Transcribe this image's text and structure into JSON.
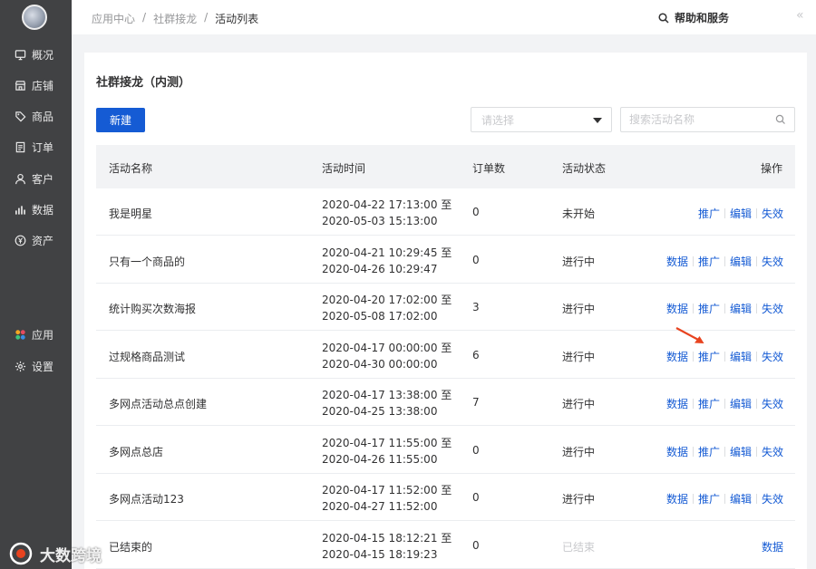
{
  "sidebar": {
    "items": [
      {
        "label": "概况",
        "icon": "monitor-icon"
      },
      {
        "label": "店铺",
        "icon": "shop-icon"
      },
      {
        "label": "商品",
        "icon": "tag-icon"
      },
      {
        "label": "订单",
        "icon": "order-icon"
      },
      {
        "label": "客户",
        "icon": "user-icon"
      },
      {
        "label": "数据",
        "icon": "bar-chart-icon"
      },
      {
        "label": "资产",
        "icon": "yen-icon"
      },
      {
        "label": "应用",
        "icon": "apps-icon"
      },
      {
        "label": "设置",
        "icon": "gear-icon"
      }
    ]
  },
  "breadcrumb": [
    "应用中心",
    "社群接龙",
    "活动列表"
  ],
  "breadcrumb_sep": "/",
  "header": {
    "help_label": "帮助和服务",
    "collapse_label": "«"
  },
  "page": {
    "title": "社群接龙（内测）",
    "new_button": "新建",
    "select_placeholder": "请选择",
    "search_placeholder": "搜索活动名称"
  },
  "table": {
    "columns": [
      "活动名称",
      "活动时间",
      "订单数",
      "活动状态",
      "操作"
    ],
    "rows": [
      {
        "name": "我是明星",
        "start": "2020-04-22 17:13:00 至",
        "end": "2020-05-03 15:13:00",
        "orders": "0",
        "status": "未开始",
        "actions": [
          "推广",
          "编辑",
          "失效"
        ]
      },
      {
        "name": "只有一个商品的",
        "start": "2020-04-21 10:29:45 至",
        "end": "2020-04-26 10:29:47",
        "orders": "0",
        "status": "进行中",
        "actions": [
          "数据",
          "推广",
          "编辑",
          "失效"
        ]
      },
      {
        "name": "统计购买次数海报",
        "start": "2020-04-20 17:02:00 至",
        "end": "2020-05-08 17:02:00",
        "orders": "3",
        "status": "进行中",
        "actions": [
          "数据",
          "推广",
          "编辑",
          "失效"
        ]
      },
      {
        "name": "过规格商品测试",
        "start": "2020-04-17 00:00:00 至",
        "end": "2020-04-30 00:00:00",
        "orders": "6",
        "status": "进行中",
        "actions": [
          "数据",
          "推广",
          "编辑",
          "失效"
        ]
      },
      {
        "name": "多网点活动总点创建",
        "start": "2020-04-17 13:38:00 至",
        "end": "2020-04-25 13:38:00",
        "orders": "7",
        "status": "进行中",
        "actions": [
          "数据",
          "推广",
          "编辑",
          "失效"
        ]
      },
      {
        "name": "多网点总店",
        "start": "2020-04-17 11:55:00 至",
        "end": "2020-04-26 11:55:00",
        "orders": "0",
        "status": "进行中",
        "actions": [
          "数据",
          "推广",
          "编辑",
          "失效"
        ]
      },
      {
        "name": "多网点活动123",
        "start": "2020-04-17 11:52:00 至",
        "end": "2020-04-27 11:52:00",
        "orders": "0",
        "status": "进行中",
        "actions": [
          "数据",
          "推广",
          "编辑",
          "失效"
        ]
      },
      {
        "name": "已结束的",
        "start": "2020-04-15 18:12:21 至",
        "end": "2020-04-15 18:19:23",
        "orders": "0",
        "status": "已结束",
        "status_muted": true,
        "actions": [
          "数据"
        ]
      }
    ]
  },
  "watermark": "大数跨境",
  "colors": {
    "sidebar": "#414244",
    "primary": "#155bd4",
    "annotation_arrow": "#e8431f"
  }
}
